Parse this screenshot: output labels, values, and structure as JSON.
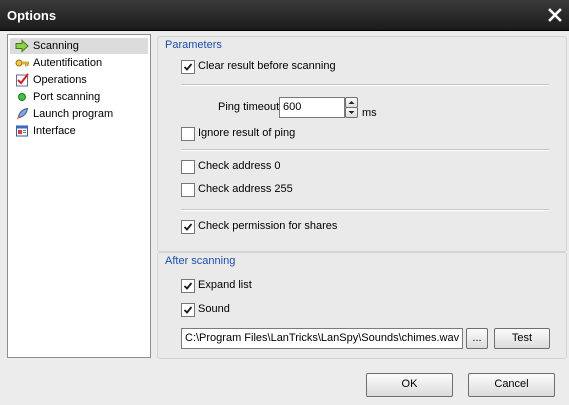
{
  "window": {
    "title": "Options"
  },
  "nav": {
    "items": [
      {
        "label": "Scanning",
        "icon": "green-arrow-icon",
        "selected": true
      },
      {
        "label": "Autentification",
        "icon": "key-icon",
        "selected": false
      },
      {
        "label": "Operations",
        "icon": "checklist-icon",
        "selected": false
      },
      {
        "label": "Port scanning",
        "icon": "green-dot-icon",
        "selected": false
      },
      {
        "label": "Launch program",
        "icon": "rocket-icon",
        "selected": false
      },
      {
        "label": "Interface",
        "icon": "window-icon",
        "selected": false
      }
    ]
  },
  "parameters": {
    "title": "Parameters",
    "clear_result": {
      "label": "Clear result before scanning",
      "checked": true
    },
    "ping_timeout": {
      "label": "Ping timeout",
      "value": "600",
      "unit": "ms"
    },
    "ignore_ping": {
      "label": "Ignore result of ping",
      "checked": false
    },
    "check_addr0": {
      "label": "Check address 0",
      "checked": false
    },
    "check_addr255": {
      "label": "Check address 255",
      "checked": false
    },
    "check_perm": {
      "label": "Check permission for shares",
      "checked": true
    }
  },
  "after": {
    "title": "After scanning",
    "expand": {
      "label": "Expand list",
      "checked": true
    },
    "sound": {
      "label": "Sound",
      "checked": true
    },
    "sound_path": "C:\\Program Files\\LanTricks\\LanSpy\\Sounds\\chimes.wav",
    "browse_label": "...",
    "test_label": "Test"
  },
  "footer": {
    "ok_label": "OK",
    "cancel_label": "Cancel"
  }
}
